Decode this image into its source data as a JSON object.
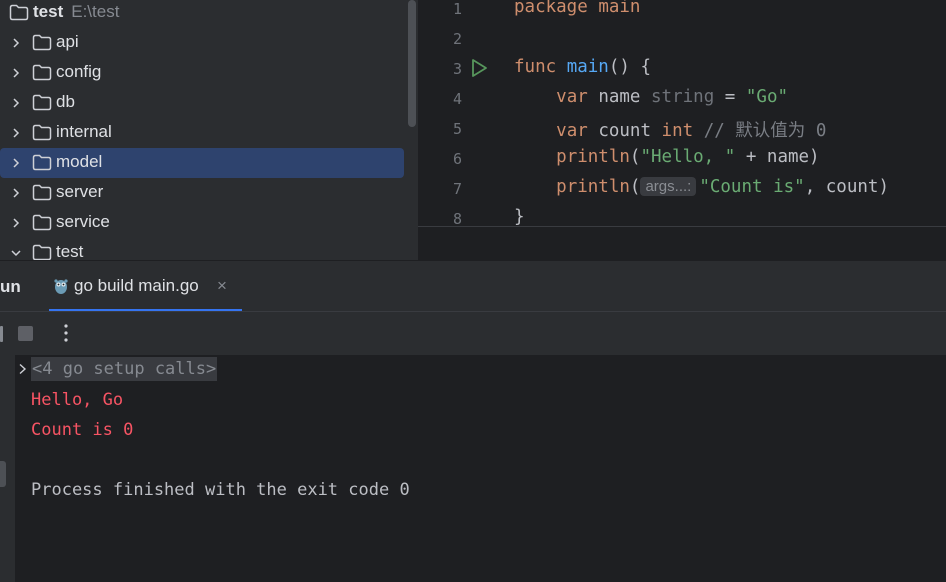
{
  "project_tree": {
    "root": {
      "name": "test",
      "path": "E:\\test"
    },
    "items": [
      {
        "label": "api"
      },
      {
        "label": "config"
      },
      {
        "label": "db"
      },
      {
        "label": "internal"
      },
      {
        "label": "model",
        "selected": true
      },
      {
        "label": "server"
      },
      {
        "label": "service"
      },
      {
        "label": "test",
        "expanded": true
      }
    ]
  },
  "editor": {
    "line_numbers": [
      "1",
      "2",
      "3",
      "4",
      "5",
      "6",
      "7",
      "8"
    ],
    "tokens": {
      "package_kw": "package",
      "package_name": "main",
      "func_kw": "func",
      "func_name": "main",
      "func_sig": "() {",
      "var_kw": "var",
      "name_ident": "name",
      "string_type": "string",
      "assign": "=",
      "go_literal": "\"Go\"",
      "count_ident": "count",
      "int_type": "int",
      "comment": "// 默认值为 0",
      "println_1": "println",
      "println_1_args_open": "(",
      "hello_literal": "\"Hello, \"",
      "println_1_rest": " + name)",
      "println_2": "println",
      "println_2_open": "(",
      "param_hint": "args...:",
      "count_literal": "\"Count is\"",
      "println_2_rest": ", count)",
      "close_brace": "}"
    }
  },
  "run_panel": {
    "title": "un",
    "tab_label": "go build main.go",
    "tab_close": "×",
    "icons": [
      "stop-icon",
      "more-vertical-icon",
      "gopher-run-icon",
      "chevron-right-icon",
      "run-gutter-icon"
    ]
  },
  "console": {
    "setup_calls": "<4 go setup calls>",
    "lines": [
      "Hello, Go",
      "Count is 0",
      "",
      "Process finished with the exit code 0"
    ]
  },
  "colors": {
    "panel_bg": "#2b2d30",
    "editor_bg": "#1e1f22",
    "selection": "#2e436e",
    "keyword": "#cf8e6d",
    "function": "#56a8f5",
    "string": "#6aab73",
    "error_output": "#f75464",
    "accent": "#3574f0"
  }
}
